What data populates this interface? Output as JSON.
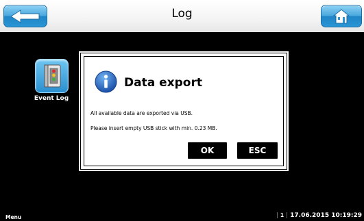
{
  "header": {
    "title": "Log",
    "back_icon": "arrow-left-icon",
    "home_icon": "home-icon"
  },
  "apps": [
    {
      "label": "Event Log",
      "icon": "event-log-book-icon"
    }
  ],
  "dialog": {
    "title": "Data export",
    "icon": "info-icon",
    "message_line1": "All available data are exported via USB.",
    "message_line2": "Please insert empty USB stick with min. 0.23 MB.",
    "ok_label": "OK",
    "esc_label": "ESC"
  },
  "footer": {
    "menu_label": "Menu",
    "page_number": "1",
    "datetime": "17.06.2015 10:19:29",
    "separator": "|"
  },
  "colors": {
    "background": "#000000",
    "button_blue": "#2a95d5",
    "dialog_bg": "#ffffff"
  }
}
